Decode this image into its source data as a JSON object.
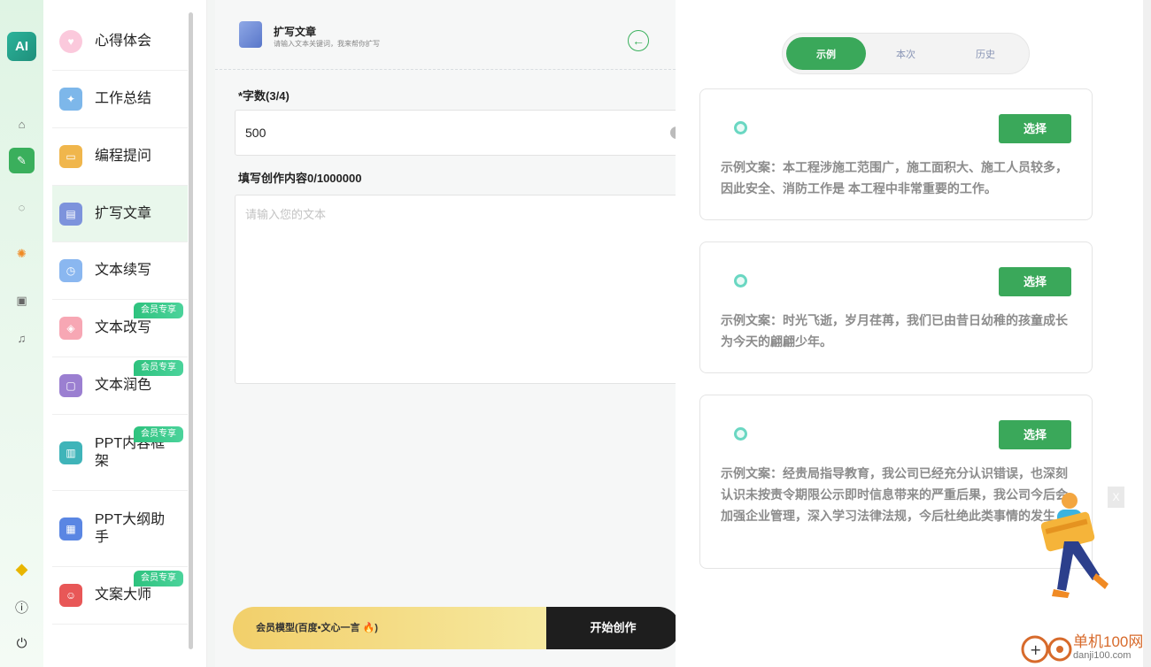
{
  "rail": {
    "logo": "AI",
    "icons": [
      "home-icon",
      "doc-icon",
      "chat-icon",
      "star-icon",
      "image-icon",
      "music-icon",
      "vip-icon",
      "info-icon",
      "power-icon"
    ]
  },
  "categories": [
    {
      "label": "心得体会",
      "icon": "heart-icon",
      "color": "#f5a3c3",
      "badge": ""
    },
    {
      "label": "工作总结",
      "icon": "worker-icon",
      "color": "#7db7ea",
      "badge": ""
    },
    {
      "label": "编程提问",
      "icon": "laptop-icon",
      "color": "#f0b64c",
      "badge": ""
    },
    {
      "label": "扩写文章",
      "icon": "book-icon",
      "color": "#7d93dc",
      "badge": ""
    },
    {
      "label": "文本续写",
      "icon": "calendar-icon",
      "color": "#8ab7f0",
      "badge": ""
    },
    {
      "label": "文本改写",
      "icon": "card-icon",
      "color": "#f7a7b4",
      "badge": "会员专享"
    },
    {
      "label": "文本润色",
      "icon": "frame-icon",
      "color": "#9b7fd1",
      "badge": "会员专享"
    },
    {
      "label": "PPT内容框架",
      "icon": "ppt-icon",
      "color": "#3fb4b9",
      "badge": "会员专享"
    },
    {
      "label": "PPT大纲助手",
      "icon": "outline-icon",
      "color": "#5a86e3",
      "badge": ""
    },
    {
      "label": "文案大师",
      "icon": "person-icon",
      "color": "#e85757",
      "badge": "会员专享"
    }
  ],
  "main": {
    "title": "扩写文章",
    "subtitle": "请输入文本关键词，我来帮你扩写",
    "word_label": "*字数(3/4)",
    "word_value": "500",
    "content_label": "填写创作内容0/1000000",
    "content_placeholder": "请输入您的文本",
    "model_label": "会员模型(百度•文心一言 🔥)",
    "start_label": "开始创作"
  },
  "tabs": [
    {
      "label": "示例",
      "active": true
    },
    {
      "label": "本次",
      "active": false
    },
    {
      "label": "历史",
      "active": false
    }
  ],
  "cards": [
    {
      "select": "选择",
      "text": "示例文案：本工程涉施工范围广，施工面积大、施工人员较多，因此安全、消防工作是 本工程中非常重要的工作。"
    },
    {
      "select": "选择",
      "text": "示例文案：时光飞逝，岁月荏苒，我们已由昔日幼稚的孩童成长为今天的翩翩少年。"
    },
    {
      "select": "选择",
      "text": "示例文案：经贵局指导教育，我公司已经充分认识错误，也深刻认识未按责令期限公示即时信息带来的严重后果，我公司今后会加强企业管理，深入学习法律法规，今后杜绝此类事情的发生"
    }
  ],
  "overlay": {
    "close": "X"
  },
  "watermark": {
    "name": "单机100网",
    "url": "danji100.com"
  },
  "colors": {
    "accent": "#3aa85a",
    "gold": "#f2cf6a"
  }
}
